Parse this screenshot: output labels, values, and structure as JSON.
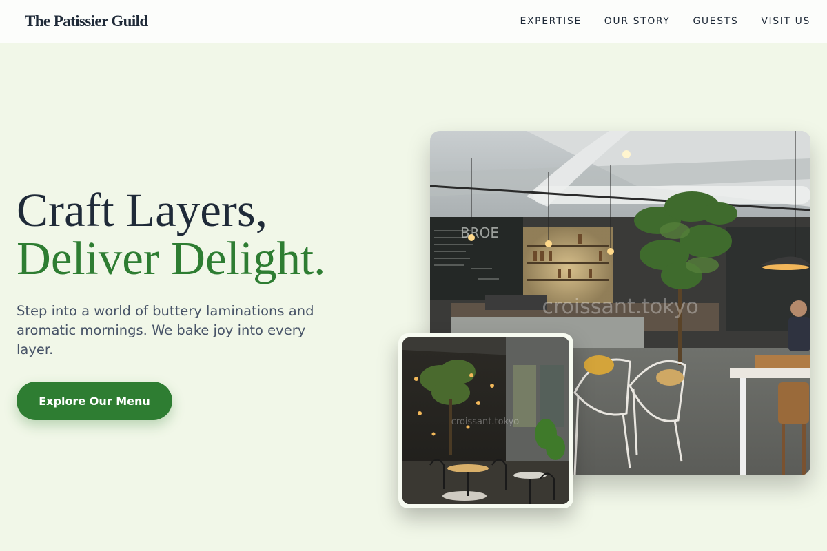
{
  "brand": {
    "name": "The Patissier Guild"
  },
  "nav": {
    "items": [
      {
        "label": "EXPERTISE"
      },
      {
        "label": "OUR STORY"
      },
      {
        "label": "GUESTS"
      },
      {
        "label": "VISIT US"
      }
    ]
  },
  "hero": {
    "headline_line1": "Craft Layers,",
    "headline_line2": "Deliver Delight.",
    "lead": "Step into a world of buttery laminations and aromatic mornings. We bake joy into every layer.",
    "cta_label": "Explore Our Menu"
  },
  "images": {
    "main_watermark": "croissant.tokyo",
    "small_watermark": "croissant.tokyo"
  },
  "colors": {
    "background": "#f1f7e8",
    "heading_dark": "#1f2a38",
    "accent_green": "#2e7d32"
  }
}
